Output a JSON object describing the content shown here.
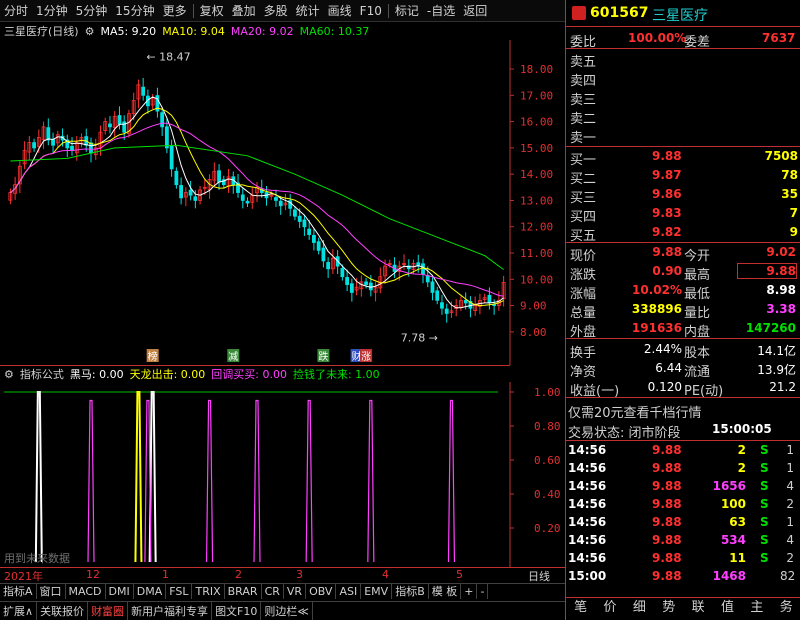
{
  "toolbar": {
    "items": [
      "分时",
      "1分钟",
      "5分钟",
      "15分钟",
      "更多",
      "复权",
      "叠加",
      "多股",
      "统计",
      "画线",
      "F10",
      "标记",
      "-自选",
      "返回"
    ]
  },
  "title": {
    "stock": "三星医疗(日线)",
    "ma5": "MA5: 9.20",
    "ma10": "MA10: 9.04",
    "ma20": "MA20: 9.02",
    "ma60": "MA60: 10.37"
  },
  "colors": {
    "ma5": "#ffffff",
    "ma10": "#ffff00",
    "ma20": "#ff40ff",
    "ma60": "#00e000",
    "up": "#ff3030",
    "down": "#00e0e0",
    "axis": "#c03030"
  },
  "price_ticks": [
    "18.00",
    "17.00",
    "16.00",
    "15.00",
    "14.00",
    "13.00",
    "12.00",
    "11.00",
    "10.00",
    "9.00",
    "8.00"
  ],
  "annotations": {
    "high": "18.47",
    "low": "7.78"
  },
  "markers": [
    {
      "text": "榜",
      "bg": "#c08040"
    },
    {
      "text": "减",
      "bg": "#3a8a3a"
    },
    {
      "text": "跌",
      "bg": "#3a8a3a"
    },
    {
      "text": "财",
      "bg": "#3050c0"
    },
    {
      "text": "涨",
      "bg": "#c03030"
    }
  ],
  "indicator": {
    "name": "指标公式",
    "heima": "黑马: 0.00",
    "tianlong": "天龙出击: 0.00",
    "huitiao": "回调买买: 0.00",
    "jianqian": "捡钱了未来: 1.00",
    "ticks": [
      "1.00",
      "0.80",
      "0.60",
      "0.40",
      "0.20"
    ],
    "note": "用到未来数据"
  },
  "xaxis": {
    "labels": [
      "2021年",
      "12",
      "1",
      "2",
      "3",
      "4",
      "5"
    ],
    "period": "日线"
  },
  "tabs1": [
    "指标A",
    "窗口",
    "MACD",
    "DMI",
    "DMA",
    "FSL",
    "TRIX",
    "BRAR",
    "CR",
    "VR",
    "OBV",
    "ASI",
    "EMV",
    "指标B",
    "模 板",
    "+",
    "-"
  ],
  "tabs2": [
    "扩展∧",
    "关联报价",
    "财富圈",
    "新用户福利专享",
    "图文F10",
    "则边栏≪"
  ],
  "sidetabs": [
    "笔",
    "价",
    "细",
    "势",
    "联",
    "值",
    "主",
    "务"
  ],
  "chart_data": [
    {
      "type": "candlestick",
      "title": "三星医疗(日线)",
      "ylim": [
        7.5,
        18.8
      ],
      "series": [
        {
          "name": "MA5",
          "last": 9.2
        },
        {
          "name": "MA10",
          "last": 9.04
        },
        {
          "name": "MA20",
          "last": 9.02
        },
        {
          "name": "MA60",
          "last": 10.37
        }
      ],
      "close": [
        13.3,
        13.6,
        14.3,
        14.9,
        15.2,
        15.0,
        15.4,
        15.8,
        15.3,
        15.1,
        15.5,
        15.3,
        15.0,
        14.9,
        15.2,
        15.4,
        15.1,
        14.8,
        15.0,
        15.6,
        16.0,
        15.8,
        16.2,
        15.9,
        15.6,
        16.3,
        16.8,
        17.4,
        17.0,
        16.6,
        16.9,
        16.4,
        15.8,
        15.0,
        14.2,
        13.6,
        13.1,
        13.3,
        13.2,
        13.0,
        13.4,
        13.5,
        13.8,
        14.1,
        13.7,
        13.6,
        13.9,
        13.6,
        13.3,
        13.0,
        12.9,
        13.2,
        13.5,
        13.3,
        13.1,
        13.2,
        13.0,
        12.8,
        12.9,
        12.7,
        12.4,
        12.2,
        12.0,
        11.7,
        11.4,
        11.1,
        10.7,
        10.4,
        10.8,
        10.5,
        10.1,
        9.8,
        9.5,
        9.7,
        9.9,
        9.8,
        9.6,
        9.7,
        10.1,
        10.5,
        10.6,
        10.3,
        10.5,
        10.6,
        10.4,
        10.6,
        10.5,
        10.2,
        9.9,
        9.5,
        9.2,
        8.9,
        8.7,
        8.8,
        9.0,
        9.2,
        9.1,
        8.9,
        9.0,
        9.2,
        9.3,
        9.1,
        9.0,
        9.2,
        9.88
      ],
      "ma60_points": [
        [
          0,
          14.5
        ],
        [
          12,
          14.6
        ],
        [
          22,
          15.0
        ],
        [
          35,
          15.1
        ],
        [
          50,
          14.7
        ],
        [
          60,
          14.0
        ],
        [
          70,
          13.2
        ],
        [
          80,
          12.3
        ],
        [
          90,
          11.6
        ],
        [
          100,
          10.9
        ],
        [
          104,
          10.37
        ]
      ]
    },
    {
      "type": "bar",
      "title": "指标公式",
      "ylim": [
        0,
        1.0
      ],
      "pulses": [
        {
          "color": "#ffffff",
          "index": 6,
          "value": 1.0
        },
        {
          "color": "#ffff00",
          "index": 27,
          "value": 1.0
        },
        {
          "color": "#ffffff",
          "index": 30,
          "value": 1.0
        },
        {
          "color": "#ff40ff",
          "index": 17,
          "value": 0.95
        },
        {
          "color": "#ff40ff",
          "index": 29,
          "value": 0.95
        },
        {
          "color": "#ff40ff",
          "index": 42,
          "value": 0.95
        },
        {
          "color": "#ff40ff",
          "index": 52,
          "value": 0.95
        },
        {
          "color": "#ff40ff",
          "index": 63,
          "value": 0.95
        },
        {
          "color": "#ff40ff",
          "index": 76,
          "value": 0.95
        },
        {
          "color": "#ff40ff",
          "index": 93,
          "value": 0.95
        }
      ]
    }
  ],
  "quote": {
    "code": "601567",
    "name": "三星医疗",
    "weibi_label": "委比",
    "weibi": "100.00%",
    "weicha_label": "委差",
    "weicha": "7637",
    "sells": [
      {
        "label": "卖五"
      },
      {
        "label": "卖四"
      },
      {
        "label": "卖三"
      },
      {
        "label": "卖二"
      },
      {
        "label": "卖一"
      }
    ],
    "buys": [
      {
        "label": "买一",
        "price": "9.88",
        "vol": "7508"
      },
      {
        "label": "买二",
        "price": "9.87",
        "vol": "78"
      },
      {
        "label": "买三",
        "price": "9.86",
        "vol": "35"
      },
      {
        "label": "买四",
        "price": "9.83",
        "vol": "7"
      },
      {
        "label": "买五",
        "price": "9.82",
        "vol": "9"
      }
    ],
    "stats": [
      {
        "l1": "现价",
        "v1": "9.88",
        "c1": "red",
        "l2": "今开",
        "v2": "9.02",
        "c2": "red"
      },
      {
        "l1": "涨跌",
        "v1": "0.90",
        "c1": "red",
        "l2": "最高",
        "v2": "9.88",
        "c2": "red"
      },
      {
        "l1": "涨幅",
        "v1": "10.02%",
        "c1": "red",
        "l2": "最低",
        "v2": "8.98",
        "c2": "wht"
      },
      {
        "l1": "总量",
        "v1": "338896",
        "c1": "yel",
        "l2": "量比",
        "v2": "3.38",
        "c2": "mag"
      },
      {
        "l1": "外盘",
        "v1": "191636",
        "c1": "red",
        "l2": "内盘",
        "v2": "147260",
        "c2": "grn"
      }
    ],
    "stats2": [
      {
        "l1": "换手",
        "v1": "2.44%",
        "l2": "股本",
        "v2": "14.1亿"
      },
      {
        "l1": "净资",
        "v1": "6.44",
        "l2": "流通",
        "v2": "13.9亿"
      },
      {
        "l1": "收益(一)",
        "v1": "0.120",
        "l2": "PE(动)",
        "v2": "21.2"
      }
    ],
    "promo": "仅需20元查看千档行情",
    "status_label": "交易状态: 闭市阶段",
    "status_time": "15:00:05",
    "trades": [
      {
        "t": "14:56",
        "p": "9.88",
        "v": "2",
        "vc": "yel",
        "s": "S",
        "n": "1"
      },
      {
        "t": "14:56",
        "p": "9.88",
        "v": "2",
        "vc": "yel",
        "s": "S",
        "n": "1"
      },
      {
        "t": "14:56",
        "p": "9.88",
        "v": "1656",
        "vc": "mag",
        "s": "S",
        "n": "4"
      },
      {
        "t": "14:56",
        "p": "9.88",
        "v": "100",
        "vc": "yel",
        "s": "S",
        "n": "2"
      },
      {
        "t": "14:56",
        "p": "9.88",
        "v": "63",
        "vc": "yel",
        "s": "S",
        "n": "1"
      },
      {
        "t": "14:56",
        "p": "9.88",
        "v": "534",
        "vc": "mag",
        "s": "S",
        "n": "4"
      },
      {
        "t": "14:56",
        "p": "9.88",
        "v": "11",
        "vc": "yel",
        "s": "S",
        "n": "2"
      },
      {
        "t": "15:00",
        "p": "9.88",
        "v": "1468",
        "vc": "mag",
        "s": "",
        "n": "82"
      }
    ]
  }
}
